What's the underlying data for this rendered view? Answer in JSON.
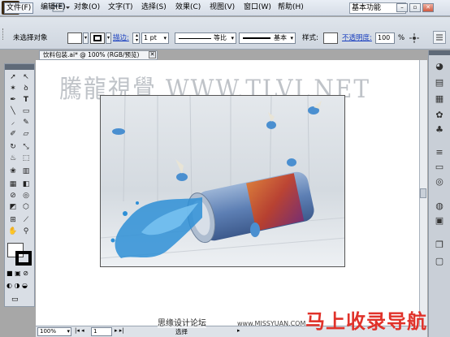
{
  "app": {
    "logo": "Ai",
    "workspace": "基本功能"
  },
  "menu": {
    "items": [
      "文件(F)",
      "编辑(E)",
      "对象(O)",
      "文字(T)",
      "选择(S)",
      "效果(C)",
      "视图(V)",
      "窗口(W)",
      "帮助(H)"
    ]
  },
  "control": {
    "selection_state": "未选择对象",
    "stroke_link": "描边:",
    "stroke_weight": "1 pt",
    "profile": "等比",
    "brush": "基本",
    "style_label": "样式:",
    "opacity_link": "不透明度:",
    "opacity_value": "100",
    "opacity_unit": "%"
  },
  "document": {
    "tab_title": "饮料包装.ai* @ 100% (RGB/预览)"
  },
  "status": {
    "zoom": "100%",
    "page": "1",
    "tool": "选择"
  },
  "overlays": {
    "watermark": "騰龍視覺 WWW.TLVI.NET",
    "site_name": "思缘设计论坛",
    "site_url": "www.MISSYUAN.COM",
    "brand": "马上收录导航"
  },
  "icons": [
    "selection-icon",
    "direct-selection-icon",
    "magic-wand-icon",
    "lasso-icon",
    "pen-icon",
    "type-icon",
    "line-icon",
    "rectangle-icon",
    "paintbrush-icon",
    "pencil-icon",
    "blob-brush-icon",
    "eraser-icon",
    "rotate-icon",
    "scale-icon",
    "warp-icon",
    "free-transform-icon",
    "symbol-sprayer-icon",
    "column-graph-icon",
    "mesh-icon",
    "gradient-icon",
    "eyedropper-icon",
    "blend-icon",
    "live-paint-icon",
    "live-paint-select-icon",
    "artboard-icon",
    "slice-icon",
    "hand-icon",
    "zoom-icon"
  ],
  "colors": {
    "accent": "#1a3fbf",
    "brand_red": "#e0322a"
  }
}
